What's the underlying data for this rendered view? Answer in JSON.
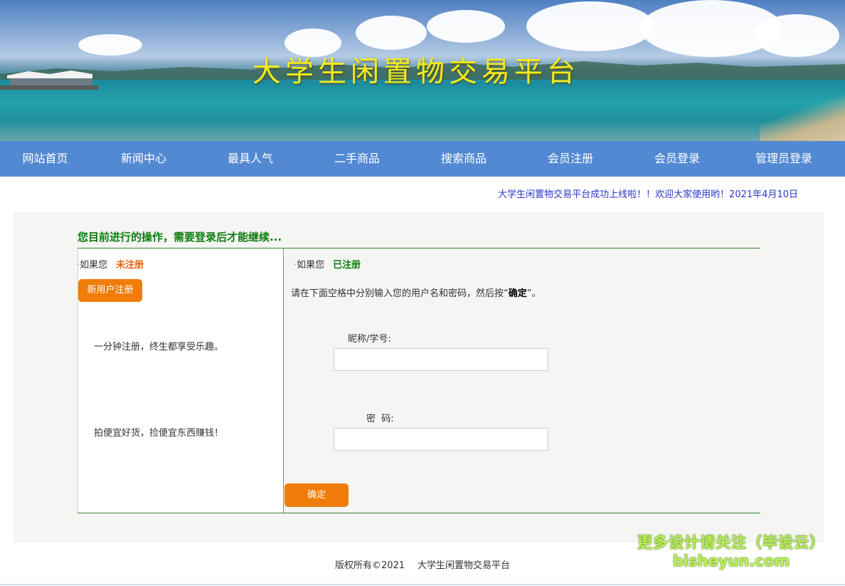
{
  "banner": {
    "title": "大学生闲置物交易平台"
  },
  "nav": [
    "网站首页",
    "新闻中心",
    "最具人气",
    "二手商品",
    "搜索商品",
    "会员注册",
    "会员登录",
    "管理员登录"
  ],
  "notice": "大学生闲置物交易平台成功上线啦！！欢迎大家使用哟！2021年4月10日",
  "panel": {
    "title": "您目前进行的操作，需要登录后才能继续...",
    "left": {
      "prefix": "如果您",
      "status": "未注册",
      "register_button": "新用户注册",
      "slogan_1": "一分钟注册，终生都享受乐趣。",
      "slogan_2": "拍便宜好货，捡便宜东西赚钱！"
    },
    "right": {
      "prefix": "如果您",
      "status": "已注册",
      "instr_before": "请在下面空格中分别输入您的用户名和密码，然后按“",
      "instr_bold": "确定",
      "instr_after": "”。",
      "username_label": "昵称/学号:",
      "username_value": "",
      "password_label": "密  码:",
      "password_value": "",
      "submit_button": "确定"
    }
  },
  "footer": {
    "copyright": "版权所有©2021",
    "site": "大学生闲置物交易平台"
  },
  "watermark": {
    "line1": "更多设计请关注（毕设云）",
    "line2": "bisheyun.com"
  },
  "colors": {
    "nav_bg": "#5289d2",
    "accent_orange": "#f07c0a",
    "title_green": "#0b7e0b",
    "notice_blue": "#2a36c8",
    "banner_title": "#f3ea1c"
  }
}
